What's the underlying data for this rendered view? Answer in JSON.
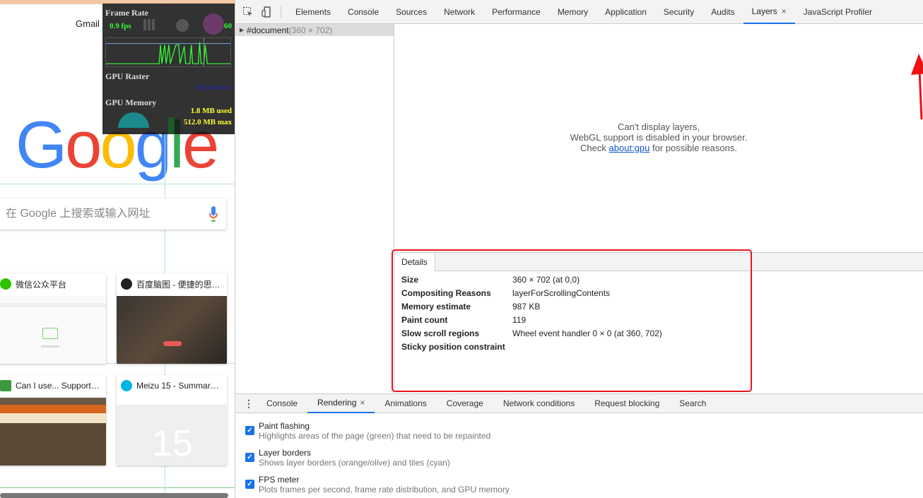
{
  "page": {
    "gmail_link": "Gmail",
    "search_placeholder": "在 Google 上搜索或输入网址",
    "tiles": [
      {
        "title": "微信公众平台"
      },
      {
        "title": "百度脑图 - 便捷的思…"
      },
      {
        "title": "Can I use... Support…"
      },
      {
        "title": "Meizu 15 - Summar…"
      }
    ],
    "fps_meter": {
      "frame_rate_label": "Frame Rate",
      "fps_value": "0.9 fps",
      "fps_range": "1-60",
      "gpu_raster_label": "GPU Raster",
      "gpu_raster_status": "off (device)",
      "gpu_memory_label": "GPU Memory",
      "gpu_memory_used": "1.8 MB used",
      "gpu_memory_max": "512.0 MB max"
    }
  },
  "devtools": {
    "tabs": [
      "Elements",
      "Console",
      "Sources",
      "Network",
      "Performance",
      "Memory",
      "Application",
      "Security",
      "Audits",
      "Layers",
      "JavaScript Profiler"
    ],
    "active_tab": "Layers",
    "close_glyph": "×",
    "layer_tree": {
      "root_label": "#document",
      "root_size": "(360 × 702)"
    },
    "viewer_message": {
      "line1": "Can't display layers,",
      "line2": "WebGL support is disabled in your browser.",
      "line3_prefix": "Check",
      "line3_link": "about:gpu",
      "line3_suffix": "for possible reasons."
    },
    "details": {
      "tab_label": "Details",
      "rows": [
        {
          "key": "Size",
          "value": "360 × 702 (at 0,0)"
        },
        {
          "key": "Compositing Reasons",
          "value": "layerForScrollingContents"
        },
        {
          "key": "Memory estimate",
          "value": "987 KB"
        },
        {
          "key": "Paint count",
          "value": "119"
        },
        {
          "key": "Slow scroll regions",
          "value": "Wheel event handler 0 × 0 (at 360, 702)"
        },
        {
          "key": "Sticky position constraint",
          "value": ""
        }
      ]
    },
    "drawer": {
      "tabs": [
        "Console",
        "Rendering",
        "Animations",
        "Coverage",
        "Network conditions",
        "Request blocking",
        "Search"
      ],
      "active_tab": "Rendering",
      "rendering_options": [
        {
          "title": "Paint flashing",
          "subtitle": "Highlights areas of the page (green) that need to be repainted",
          "checked": true
        },
        {
          "title": "Layer borders",
          "subtitle": "Shows layer borders (orange/olive) and tiles (cyan)",
          "checked": true
        },
        {
          "title": "FPS meter",
          "subtitle": "Plots frames per second, frame rate distribution, and GPU memory",
          "checked": true
        }
      ]
    }
  },
  "colors": {
    "accent": "#1a73e8",
    "annotation_red": "#e8141c"
  }
}
